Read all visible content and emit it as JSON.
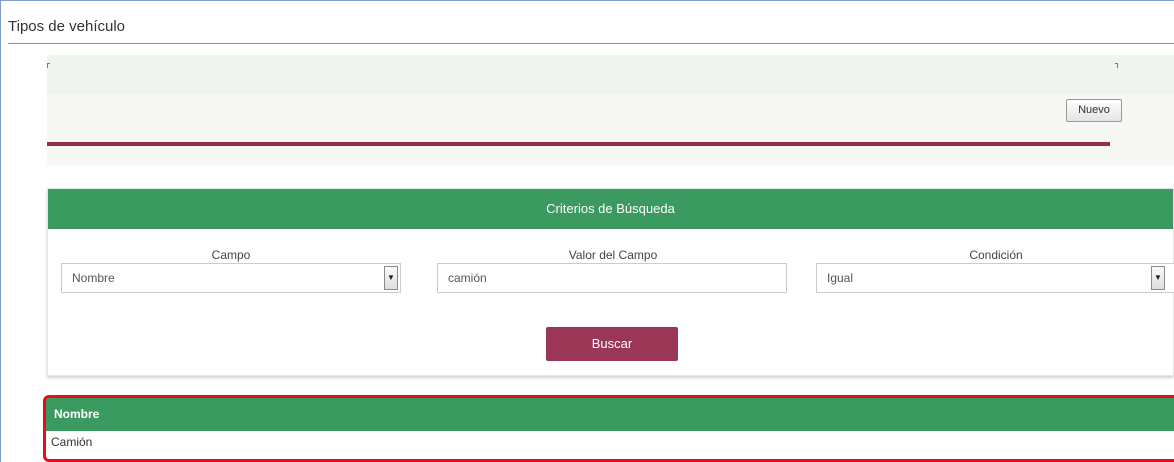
{
  "page": {
    "title": "Tipos de vehículo"
  },
  "toolbar": {
    "new_label": "Nuevo"
  },
  "search": {
    "header": "Criterios de Búsqueda",
    "fields": {
      "campo": {
        "label": "Campo",
        "value": "Nombre"
      },
      "valor": {
        "label": "Valor del Campo",
        "value": "camión"
      },
      "condicion": {
        "label": "Condición",
        "value": "Igual"
      }
    },
    "button_label": "Buscar"
  },
  "results": {
    "columns": [
      "Nombre"
    ],
    "rows": [
      [
        "Camión"
      ]
    ]
  },
  "colors": {
    "accent_green": "#3a9a60",
    "accent_maroon": "#9c2a4e",
    "highlight_red": "#e10f16"
  },
  "icons": {
    "select_arrow": "chevron-down-icon"
  }
}
